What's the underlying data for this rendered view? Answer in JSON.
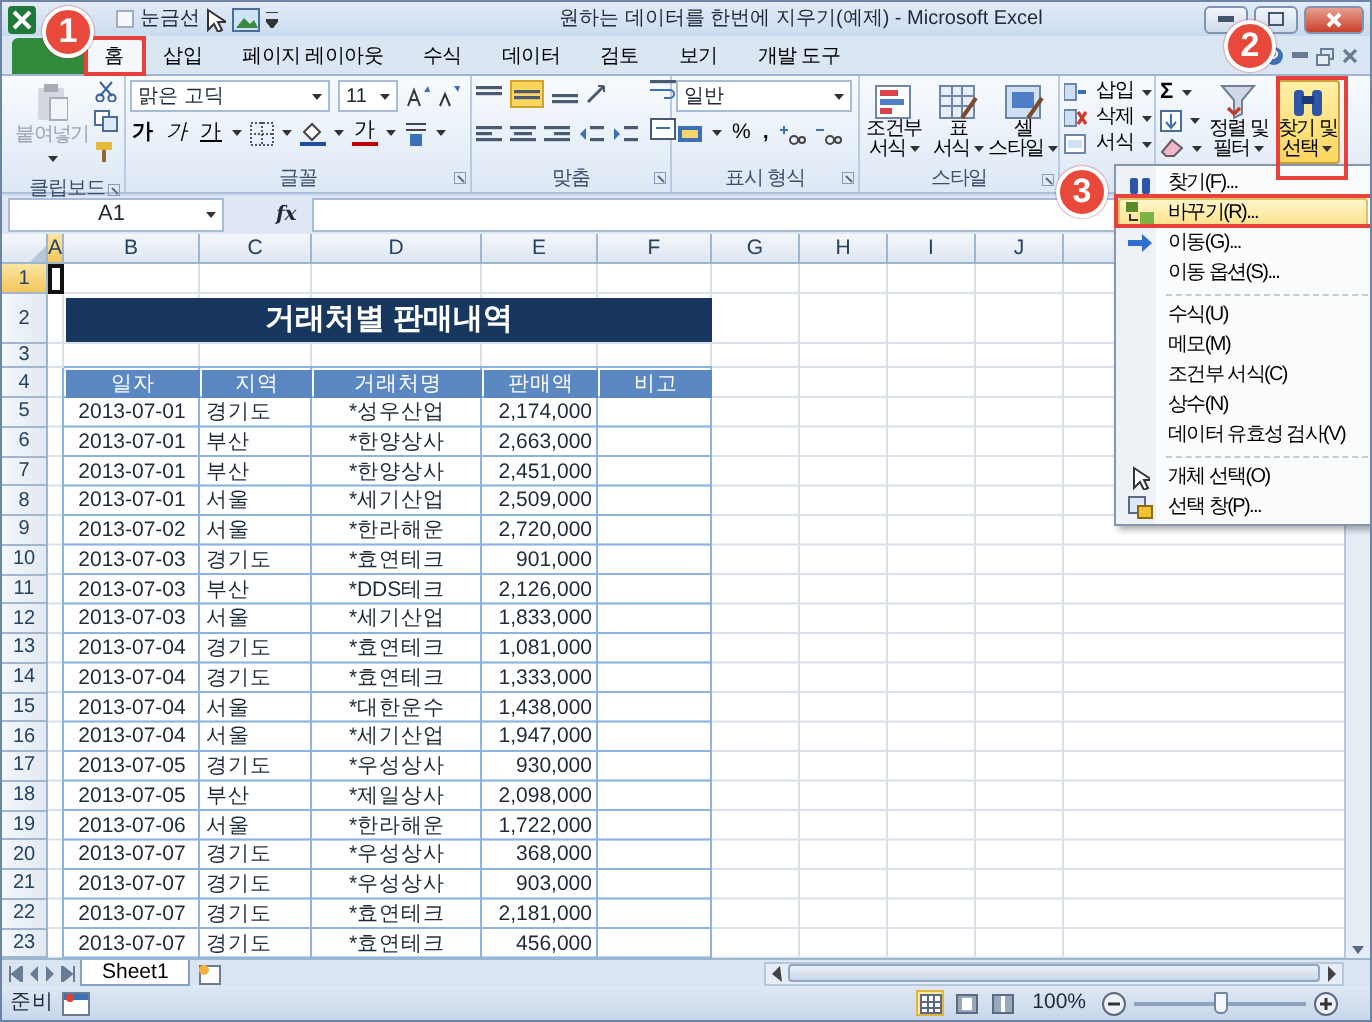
{
  "window": {
    "title": "원하는 데이터를 한번에 지우기(예제) - Microsoft Excel"
  },
  "quick_access": {
    "label": "눈금선",
    "checked": false
  },
  "tabs": [
    {
      "kind": "file",
      "selected": false
    },
    {
      "label": "홈",
      "kind": "tab",
      "selected": true
    },
    {
      "label": "삽입",
      "kind": "tab",
      "selected": false
    },
    {
      "label": "페이지 레이아웃",
      "kind": "tab",
      "selected": false
    },
    {
      "label": "수식",
      "kind": "tab",
      "selected": false
    },
    {
      "label": "데이터",
      "kind": "tab",
      "selected": false
    },
    {
      "label": "검토",
      "kind": "tab",
      "selected": false
    },
    {
      "label": "보기",
      "kind": "tab",
      "selected": false
    },
    {
      "label": "개발 도구",
      "kind": "tab",
      "selected": false
    }
  ],
  "ribbon": {
    "clipboard": {
      "label": "클립보드",
      "paste": {
        "label": "붙여넣기",
        "disabled": true
      }
    },
    "font": {
      "label": "글꼴",
      "name": "맑은 고딕",
      "size": "11",
      "bold": "가",
      "italic": "가",
      "underline": "가",
      "font_color": "가"
    },
    "alignment": {
      "label": "맞춤"
    },
    "number": {
      "label": "표시 형식",
      "format": "일반",
      "percent": "%",
      "comma": ","
    },
    "styles": {
      "label": "스타일",
      "buttons": [
        {
          "lines": [
            "조건부",
            "서식"
          ]
        },
        {
          "lines": [
            "표",
            "서식"
          ]
        },
        {
          "lines": [
            "셀",
            "스타일"
          ]
        }
      ]
    },
    "cells": {
      "buttons": [
        "삽입",
        "삭제",
        "서식"
      ]
    },
    "editing": {
      "sum": "Σ",
      "sort": {
        "lines": [
          "정렬 및",
          "필터"
        ]
      },
      "find": {
        "lines": [
          "찾기 및",
          "선택"
        ],
        "selected": true
      }
    }
  },
  "formula_bar": {
    "name_box": "A1",
    "function_label": "fx"
  },
  "sheet": {
    "column_letters": [
      {
        "label": "A",
        "selected": true
      },
      {
        "label": "B",
        "selected": false
      },
      {
        "label": "C",
        "selected": false
      },
      {
        "label": "D",
        "selected": false
      },
      {
        "label": "E",
        "selected": false
      },
      {
        "label": "F",
        "selected": false
      },
      {
        "label": "G",
        "selected": false
      },
      {
        "label": "H",
        "selected": false
      },
      {
        "label": "I",
        "selected": false
      },
      {
        "label": "J",
        "selected": false
      }
    ],
    "row_numbers": [
      {
        "label": "1",
        "selected": true
      },
      {
        "label": "2",
        "selected": false
      },
      {
        "label": "3",
        "selected": false
      },
      {
        "label": "4",
        "selected": false
      },
      {
        "label": "5",
        "selected": false
      },
      {
        "label": "6",
        "selected": false
      },
      {
        "label": "7",
        "selected": false
      },
      {
        "label": "8",
        "selected": false
      },
      {
        "label": "9",
        "selected": false
      },
      {
        "label": "10",
        "selected": false
      },
      {
        "label": "11",
        "selected": false
      },
      {
        "label": "12",
        "selected": false
      },
      {
        "label": "13",
        "selected": false
      },
      {
        "label": "14",
        "selected": false
      },
      {
        "label": "15",
        "selected": false
      },
      {
        "label": "16",
        "selected": false
      },
      {
        "label": "17",
        "selected": false
      },
      {
        "label": "18",
        "selected": false
      },
      {
        "label": "19",
        "selected": false
      },
      {
        "label": "20",
        "selected": false
      },
      {
        "label": "21",
        "selected": false
      },
      {
        "label": "22",
        "selected": false
      },
      {
        "label": "23",
        "selected": false
      }
    ],
    "title": "거래처별 판매내역",
    "table": {
      "columns": [
        "일자",
        "지역",
        "거래처명",
        "판매액",
        "비고"
      ],
      "rows": [
        [
          "2013-07-01",
          "경기도",
          "*성우산업",
          "2,174,000"
        ],
        [
          "2013-07-01",
          "부산",
          "*한양상사",
          "2,663,000"
        ],
        [
          "2013-07-01",
          "부산",
          "*한양상사",
          "2,451,000"
        ],
        [
          "2013-07-01",
          "서울",
          "*세기산업",
          "2,509,000"
        ],
        [
          "2013-07-02",
          "서울",
          "*한라해운",
          "2,720,000"
        ],
        [
          "2013-07-03",
          "경기도",
          "*효연테크",
          "901,000"
        ],
        [
          "2013-07-03",
          "부산",
          "*DDS테크",
          "2,126,000"
        ],
        [
          "2013-07-03",
          "서울",
          "*세기산업",
          "1,833,000"
        ],
        [
          "2013-07-04",
          "경기도",
          "*효연테크",
          "1,081,000"
        ],
        [
          "2013-07-04",
          "경기도",
          "*효연테크",
          "1,333,000"
        ],
        [
          "2013-07-04",
          "서울",
          "*대한운수",
          "1,438,000"
        ],
        [
          "2013-07-04",
          "서울",
          "*세기산업",
          "1,947,000"
        ],
        [
          "2013-07-05",
          "경기도",
          "*우성상사",
          "930,000"
        ],
        [
          "2013-07-05",
          "부산",
          "*제일상사",
          "2,098,000"
        ],
        [
          "2013-07-06",
          "서울",
          "*한라해운",
          "1,722,000"
        ],
        [
          "2013-07-07",
          "경기도",
          "*우성상사",
          "368,000"
        ],
        [
          "2013-07-07",
          "경기도",
          "*우성상사",
          "903,000"
        ],
        [
          "2013-07-07",
          "경기도",
          "*효연테크",
          "2,181,000"
        ],
        [
          "2013-07-07",
          "경기도",
          "*효연테크",
          "456,000"
        ]
      ]
    }
  },
  "sheet_tabs": [
    {
      "label": "Sheet1",
      "selected": true
    }
  ],
  "status_bar": {
    "mode": "준비",
    "views": [
      {
        "selected": true
      },
      {
        "selected": false
      },
      {
        "selected": false
      }
    ],
    "zoom": "100%",
    "zoom_slider": {
      "level": 0.5
    }
  },
  "menu": {
    "items": [
      {
        "kind": "item",
        "label": "찾기(F)...",
        "selected": false
      },
      {
        "kind": "item",
        "label": "바꾸기(R)...",
        "selected": true
      },
      {
        "kind": "item",
        "label": "이동(G)...",
        "selected": false
      },
      {
        "kind": "item",
        "label": "이동 옵션(S)...",
        "selected": false
      },
      {
        "kind": "separator"
      },
      {
        "kind": "item",
        "label": "수식(U)",
        "selected": false
      },
      {
        "kind": "item",
        "label": "메모(M)",
        "selected": false
      },
      {
        "kind": "item",
        "label": "조건부 서식(C)",
        "selected": false
      },
      {
        "kind": "item",
        "label": "상수(N)",
        "selected": false
      },
      {
        "kind": "item",
        "label": "데이터 유효성 검사(V)",
        "selected": false
      },
      {
        "kind": "separator"
      },
      {
        "kind": "item",
        "label": "개체 선택(O)",
        "selected": false
      },
      {
        "kind": "item",
        "label": "선택 창(P)...",
        "selected": false
      }
    ]
  },
  "callouts": [
    {
      "label": "1"
    },
    {
      "label": "2"
    },
    {
      "label": "3"
    }
  ]
}
